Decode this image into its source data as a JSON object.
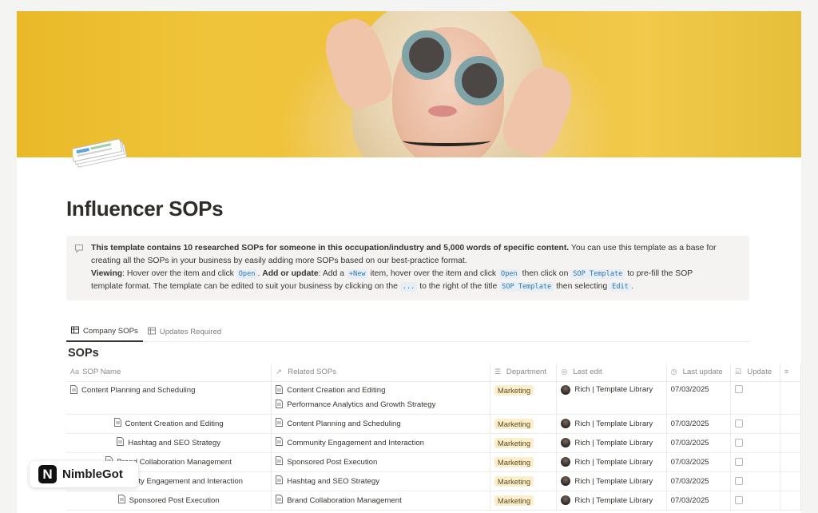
{
  "page": {
    "title": "Influencer SOPs",
    "icon": "documents-stack-icon",
    "cover": "photo-woman-round-sunglasses-yellow-wall"
  },
  "callout": {
    "icon": "speech-bubble-icon",
    "bold_intro": "This template contains 10 researched SOPs for someone in this occupation/industry and 5,000 words of specific content.",
    "intro_rest": " You can use this template as a base for",
    "line2": "creating all the SOPs in your business by easily adding more SOPs based on our best-practice format.",
    "viewing_label": "Viewing",
    "viewing_text_a": ": Hover over the item and click ",
    "open_code": "Open",
    "period_space": ". ",
    "add_label": "Add or update",
    "add_text_a": ": Add a ",
    "new_code": "+New",
    "add_text_b": " item, hover over the item and click ",
    "add_text_c": " then click on ",
    "sop_template_code": "SOP Template",
    "add_text_d": " to pre-fill the SOP",
    "line4_a": "template format. The template can be edited to suit your business by clicking on the ",
    "dots_code": "...",
    "line4_b": " to the right of the title ",
    "line4_c": " then selecting ",
    "edit_code": "Edit",
    "line4_d": "."
  },
  "tabs": [
    {
      "label": "Company SOPs",
      "icon": "table-icon",
      "active": true
    },
    {
      "label": "Updates Required",
      "icon": "table-icon",
      "active": false
    }
  ],
  "database": {
    "title": "SOPs",
    "columns": [
      {
        "label": "SOP Name",
        "icon": "Aa"
      },
      {
        "label": "Related SOPs",
        "icon": "↗"
      },
      {
        "label": "Department",
        "icon": "☰"
      },
      {
        "label": "Last edit",
        "icon": "person-icon"
      },
      {
        "label": "Last update",
        "icon": "clock-icon"
      },
      {
        "label": "Update",
        "icon": "checkbox-icon"
      },
      {
        "label": "",
        "icon": "text-icon"
      }
    ],
    "rows": [
      {
        "name": "Content Planning and Scheduling",
        "related": [
          "Content Creation and Editing",
          "Performance Analytics and Growth Strategy"
        ],
        "department": "Marketing",
        "last_edit": "Rich | Template Library",
        "last_update": "07/03/2025"
      },
      {
        "name": "Content Creation and Editing",
        "related": [
          "Content Planning and Scheduling"
        ],
        "department": "Marketing",
        "last_edit": "Rich | Template Library",
        "last_update": "07/03/2025"
      },
      {
        "name": "Hashtag and SEO Strategy",
        "related": [
          "Community Engagement and Interaction"
        ],
        "department": "Marketing",
        "last_edit": "Rich | Template Library",
        "last_update": "07/03/2025"
      },
      {
        "name": "Brand Collaboration Management",
        "related": [
          "Sponsored Post Execution"
        ],
        "department": "Marketing",
        "last_edit": "Rich | Template Library",
        "last_update": "07/03/2025"
      },
      {
        "name": "Community Engagement and Interaction",
        "related": [
          "Hashtag and SEO Strategy"
        ],
        "department": "Marketing",
        "last_edit": "Rich | Template Library",
        "last_update": "07/03/2025"
      },
      {
        "name": "Sponsored Post Execution",
        "related": [
          "Brand Collaboration Management"
        ],
        "department": "Marketing",
        "last_edit": "Rich | Template Library",
        "last_update": "07/03/2025"
      }
    ]
  },
  "watermark": {
    "logo_letter": "N",
    "name": "NimbleGot"
  },
  "colors": {
    "tag_bg": "#fbeecb",
    "code_text": "#2e77b5",
    "callout_bg": "#f4f3f1"
  }
}
